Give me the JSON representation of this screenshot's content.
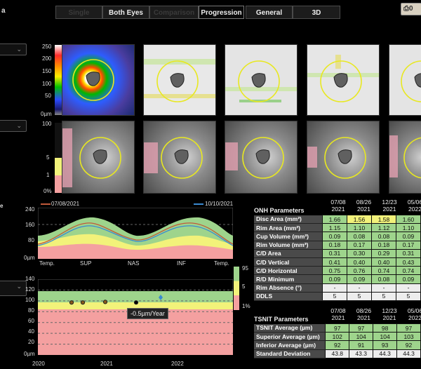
{
  "header": {
    "title_fragment": "a",
    "tabs": [
      {
        "label": "Single",
        "state": "dim"
      },
      {
        "label": "Both Eyes",
        "state": "normal"
      },
      {
        "label": "Comparison",
        "state": "dim"
      },
      {
        "label": "Progression",
        "state": "active"
      },
      {
        "label": "General",
        "state": "normal"
      },
      {
        "label": "3D",
        "state": "normal"
      }
    ],
    "print_label": "⎙0"
  },
  "colors": {
    "normal": "#9ed48c",
    "borderline": "#f2f27a",
    "outside": "#f4a0a0",
    "line_red": "#c05a3a",
    "line_blue": "#3a8ad0"
  },
  "thickness_scale": {
    "labels": [
      "250",
      "200",
      "150",
      "100",
      "50",
      "0µm"
    ]
  },
  "probability_scale": {
    "labels": [
      "100",
      "5",
      "1",
      "0%"
    ]
  },
  "tsnit": {
    "legend_left": "07/08/2021",
    "legend_right": "10/10/2021",
    "y_ticks": [
      "240",
      "160",
      "80",
      "0µm"
    ],
    "x_labels": [
      "Temp.",
      "SUP",
      "NAS",
      "INF",
      "Temp."
    ],
    "side_scale": [
      "95",
      "5",
      "1%"
    ],
    "side_label": "e"
  },
  "trend": {
    "y_ticks": [
      "140",
      "120",
      "100",
      "80",
      "60",
      "40",
      "20",
      "0µm"
    ],
    "x_labels": [
      "2020",
      "2021",
      "2022"
    ],
    "rate_label": "-0.5µm/Year"
  },
  "chart_data": {
    "type": "scatter",
    "title": "",
    "xlabel": "",
    "ylabel": "",
    "x": [
      "07/08/2021",
      "08/26/2021",
      "12/23/2021",
      "05/06/2022"
    ],
    "series": [
      {
        "values": [
          97,
          97,
          98,
          97
        ]
      }
    ],
    "trend_rate": "-0.5µm/Year",
    "ylim": [
      0,
      140
    ]
  },
  "onh": {
    "title": "ONH Parameters",
    "dates": [
      [
        "07/08",
        "2021"
      ],
      [
        "08/26",
        "2021"
      ],
      [
        "12/23",
        "2021"
      ],
      [
        "05/06",
        "2022"
      ]
    ],
    "rows": [
      {
        "label": "Disc Area (mm²)",
        "values": [
          "1.66",
          "1.56",
          "1.58",
          "1.60"
        ],
        "colors": [
          "g",
          "y",
          "y",
          "g"
        ]
      },
      {
        "label": "Rim Area (mm²)",
        "values": [
          "1.15",
          "1.10",
          "1.12",
          "1.10"
        ],
        "colors": [
          "g",
          "g",
          "g",
          "g"
        ]
      },
      {
        "label": "Cup Volume (mm³)",
        "values": [
          "0.09",
          "0.08",
          "0.08",
          "0.09"
        ],
        "colors": [
          "g",
          "g",
          "g",
          "g"
        ]
      },
      {
        "label": "Rim Volume (mm³)",
        "values": [
          "0.18",
          "0.17",
          "0.18",
          "0.17"
        ],
        "colors": [
          "g",
          "g",
          "g",
          "g"
        ]
      },
      {
        "label": "C/D Area",
        "values": [
          "0.31",
          "0.30",
          "0.29",
          "0.31"
        ],
        "colors": [
          "g",
          "g",
          "g",
          "g"
        ]
      },
      {
        "label": "C/D Vertical",
        "values": [
          "0.41",
          "0.40",
          "0.40",
          "0.43"
        ],
        "colors": [
          "g",
          "g",
          "g",
          "g"
        ]
      },
      {
        "label": "C/D Horizontal",
        "values": [
          "0.75",
          "0.76",
          "0.74",
          "0.74"
        ],
        "colors": [
          "g",
          "g",
          "g",
          "g"
        ]
      },
      {
        "label": "R/D Minimum",
        "values": [
          "0.09",
          "0.09",
          "0.08",
          "0.09"
        ],
        "colors": [
          "g",
          "g",
          "g",
          "g"
        ]
      },
      {
        "label": "Rim Absence (°)",
        "values": [
          "-",
          "-",
          "-",
          "-"
        ],
        "colors": [
          "w",
          "w",
          "w",
          "w"
        ]
      },
      {
        "label": "DDLS",
        "values": [
          "5",
          "5",
          "5",
          "5"
        ],
        "colors": [
          "w",
          "w",
          "w",
          "w"
        ]
      }
    ]
  },
  "tsnit_table": {
    "title": "TSNIT Parameters",
    "dates": [
      [
        "07/08",
        "2021"
      ],
      [
        "08/26",
        "2021"
      ],
      [
        "12/23",
        "2021"
      ],
      [
        "05/06",
        "2022"
      ]
    ],
    "rows": [
      {
        "label": "TSNIT Average (µm)",
        "values": [
          "97",
          "97",
          "98",
          "97"
        ],
        "colors": [
          "g",
          "g",
          "g",
          "g"
        ]
      },
      {
        "label": "Superior Average (µm)",
        "values": [
          "102",
          "104",
          "104",
          "103"
        ],
        "colors": [
          "g",
          "g",
          "g",
          "g"
        ]
      },
      {
        "label": "Inferior Average (µm)",
        "values": [
          "92",
          "91",
          "93",
          "92"
        ],
        "colors": [
          "g",
          "g",
          "g",
          "g"
        ]
      },
      {
        "label": "Standard Deviation",
        "values": [
          "43.8",
          "43.3",
          "44.3",
          "44.3"
        ],
        "colors": [
          "w",
          "w",
          "w",
          "w"
        ]
      }
    ]
  }
}
